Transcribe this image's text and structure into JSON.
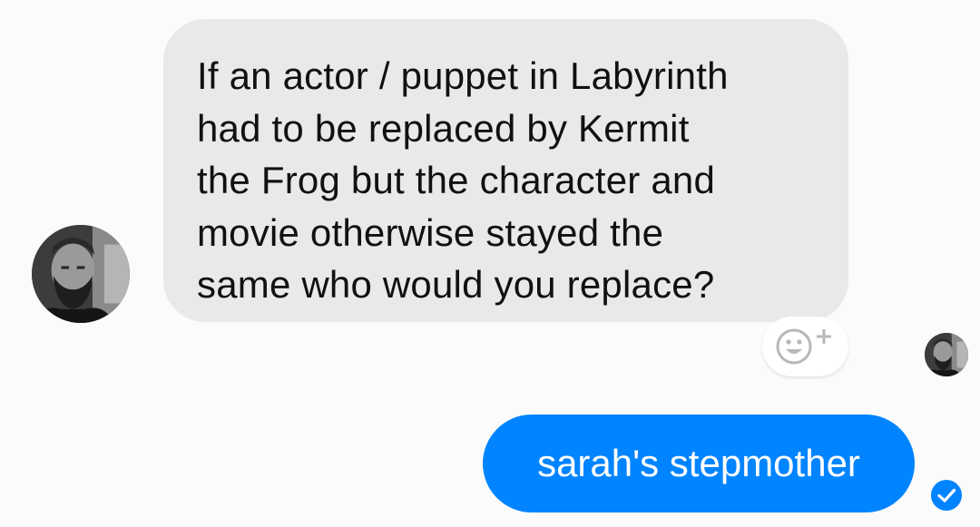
{
  "thread": {
    "incoming_message": {
      "lines": [
        "If an actor / puppet in Labyrinth",
        "had to be replaced by Kermit",
        "the Frog but the character and",
        "movie otherwise stayed the",
        "same who would you replace?"
      ],
      "sender_avatar_icon": "bearded-man-avatar",
      "bubble_color": "#e9e9eb"
    },
    "reaction_button": {
      "icon": "add-reaction-icon"
    },
    "read_receipt": {
      "icon": "bearded-man-avatar"
    },
    "outgoing_message": {
      "text": "sarah's stepmother",
      "bubble_color": "#0084ff"
    },
    "delivery_status": {
      "icon": "delivered-check-icon",
      "color": "#0084ff"
    }
  }
}
